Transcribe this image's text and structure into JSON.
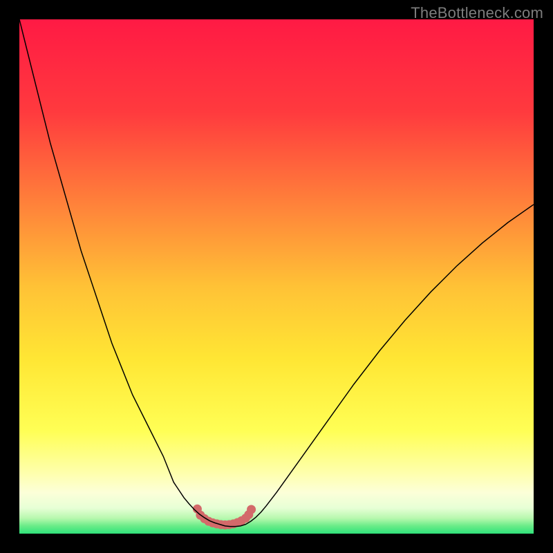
{
  "watermark": "TheBottleneck.com",
  "chart_data": {
    "type": "line",
    "title": "",
    "xlabel": "",
    "ylabel": "",
    "xlim": [
      0,
      100
    ],
    "ylim": [
      0,
      100
    ],
    "grid": false,
    "legend": false,
    "annotations": [],
    "curve": {
      "x": [
        0,
        2,
        4,
        6,
        8,
        10,
        12,
        14,
        16,
        18,
        20,
        22,
        24,
        26,
        28,
        30,
        31,
        32,
        33,
        34,
        35,
        36,
        37,
        38,
        39,
        40,
        41,
        42,
        43,
        44,
        45,
        46,
        47,
        48,
        50,
        55,
        60,
        65,
        70,
        75,
        80,
        85,
        90,
        95,
        100
      ],
      "y": [
        100,
        92,
        84,
        76,
        69,
        62,
        55,
        49,
        43,
        37,
        32,
        27,
        23,
        19,
        15,
        10,
        8.5,
        7,
        5.8,
        4.7,
        3.8,
        3.1,
        2.5,
        2.1,
        1.8,
        1.5,
        1.4,
        1.4,
        1.5,
        1.8,
        2.4,
        3.2,
        4.2,
        5.4,
        8,
        15,
        22,
        29,
        35.5,
        41.5,
        47,
        52,
        56.5,
        60.5,
        64
      ],
      "color": "#000000",
      "width": 1.5
    },
    "marker_region": {
      "x": [
        34.6,
        35.2,
        36.0,
        36.8,
        37.6,
        38.4,
        39.2,
        40.0,
        40.8,
        41.6,
        42.4,
        43.2,
        44.0,
        44.6,
        45.1
      ],
      "y": [
        4.8,
        3.6,
        2.9,
        2.4,
        2.1,
        1.9,
        1.75,
        1.7,
        1.75,
        1.9,
        2.15,
        2.5,
        3.0,
        3.7,
        4.7
      ],
      "color": "#d36a6a",
      "width": 9
    },
    "background_gradient": {
      "top": "#ff1a44",
      "mid_upper": "#ff7a3a",
      "mid": "#ffd434",
      "mid_lower": "#ffff55",
      "near_bottom": "#fdffc2",
      "bottom": "#2fe27a"
    }
  }
}
